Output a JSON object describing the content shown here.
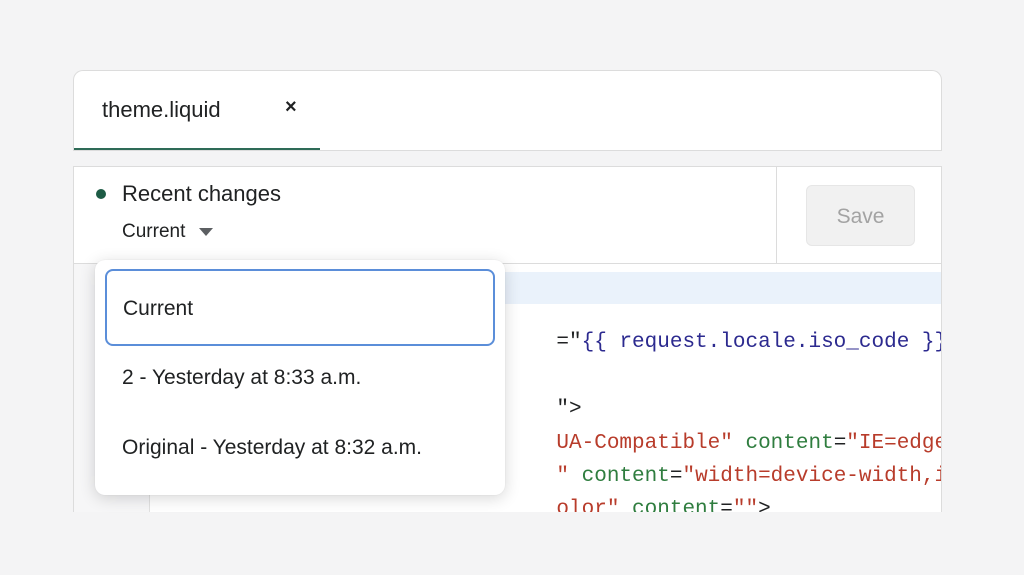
{
  "tabs": [
    {
      "label": "theme.liquid",
      "close_glyph": "×"
    }
  ],
  "toolbar": {
    "title": "Recent changes",
    "status_color": "#1d5b45",
    "version_selected": "Current",
    "save_label": "Save"
  },
  "dropdown": {
    "options": [
      {
        "label": "Current",
        "selected": true
      },
      {
        "label": "2 - Yesterday at 8:33 a.m.",
        "selected": false
      },
      {
        "label": "Original - Yesterday at 8:32 a.m.",
        "selected": false
      }
    ]
  },
  "code": {
    "line1": {
      "a": "=\"",
      "b": "{{ request.locale.iso_code }}"
    },
    "line2": {
      "a": "\">"
    },
    "line3": {
      "a": "UA-Compatible\"",
      "b": " content",
      "c": "=",
      "d": "\"IE=edge"
    },
    "line4": {
      "a": "\"",
      "b": " content",
      "c": "=",
      "d": "\"width=device-width,i"
    },
    "line5": {
      "a": "olor\"",
      "b": " content",
      "c": "=",
      "d": "\"\"",
      "e": ">"
    }
  },
  "colors": {
    "tab_underline": "#2e6b57",
    "focus_ring": "#5b8ed9",
    "string": "#b83c2b",
    "attribute": "#2f7d3f",
    "liquid_var": "#2c2a8f"
  },
  "icons": {
    "close": "close-icon",
    "dropdown": "caret-down-icon",
    "status": "status-dot-icon"
  }
}
